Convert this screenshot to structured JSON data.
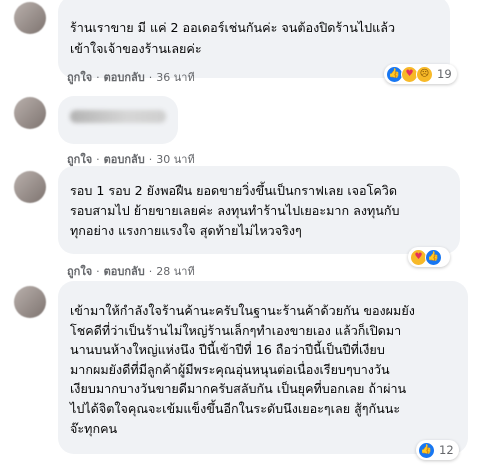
{
  "comments": [
    {
      "name_visible": false,
      "text": "ร้านเราขาย มี แค่ 2 ออเดอร์เช่นกันค่ะ จนต้องปิดร้านไปแล้ว\nเข้าใจเจ้าของร้านเลยค่ะ",
      "like_label": "ถูกใจ",
      "reply_label": "ตอบกลับ",
      "time": "36 นาที",
      "reactions": {
        "icons": [
          "like-icon",
          "care-icon",
          "sad-icon"
        ],
        "count": "19"
      }
    },
    {
      "name_visible": false,
      "text": "",
      "like_label": "ถูกใจ",
      "reply_label": "ตอบกลับ",
      "time": "30 นาที"
    },
    {
      "name_visible": false,
      "text": "รอบ 1 รอบ 2 ยังพอฝืน ยอดขายวิ่งขึ้นเป็นกราฟเลย เจอโควิด\nรอบสามไป ย้ายขายเลยค่ะ ลงทุนทำร้านไปเยอะมาก ลงทุนกับ\nทุกอย่าง แรงกายแรงใจ สุดท้ายไม่ไหวจริงๆ",
      "like_label": "ถูกใจ",
      "reply_label": "ตอบกลับ",
      "time": "28 นาที",
      "reactions": {
        "icons": [
          "care-icon",
          "like-icon"
        ],
        "count": ""
      }
    },
    {
      "name_visible": false,
      "text": "เข้ามาให้กำลังใจร้านค้านะครับในฐานะร้านค้าด้วยกัน ของผมยัง\nโชคดีที่ว่าเป็นร้านไม่ใหญ่ร้านเล็กๆทำเองขายเอง แล้วก็เปิดมา\nนานบนห้างใหญ่แห่งนึง ปีนี้เข้าปีที่ 16 ถือว่าปีนี้เป็นปีที่เงียบ\nมากผมยังดีที่มีลูกค้าผู้มีพระคุณอุ่นหนุนต่อเนื่องเรียบๆบางวัน\nเงียบมากบางวันขายดีมากครับสลับกัน เป็นยุคที่บอกเลย ถ้าผ่าน\nไปได้จิตใจคุณจะเข้มแข็งขึ้นอีกในระดับนึงเยอะๆเลย สู้ๆกันนะ\nจ๊ะทุกคน",
      "like_label": "ถูกใจ",
      "reply_label": "ตอบกลับ",
      "time": "28 นาที",
      "reactions": {
        "icons": [
          "like-icon"
        ],
        "count": "12"
      }
    }
  ]
}
